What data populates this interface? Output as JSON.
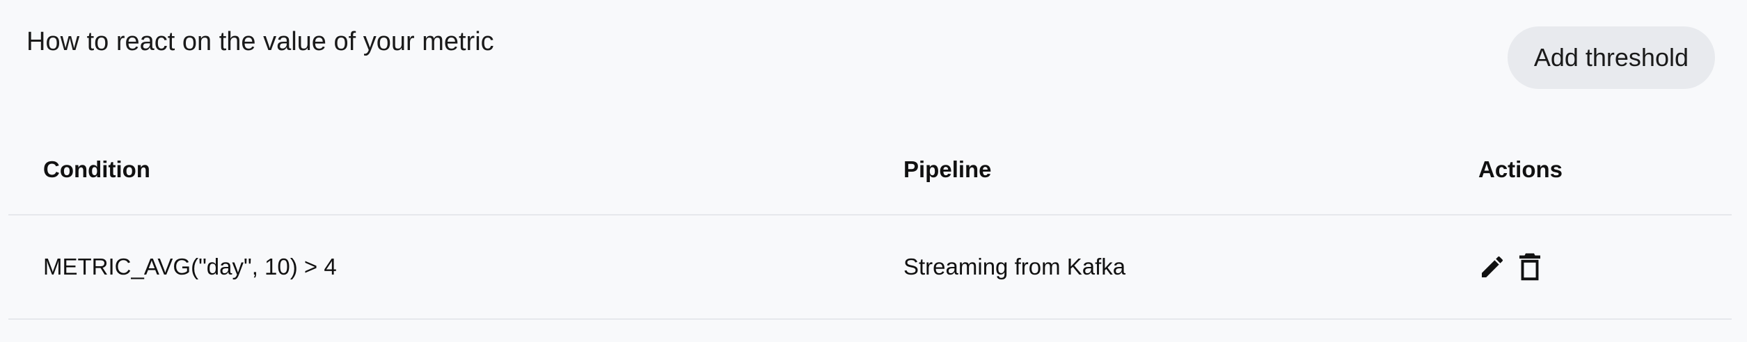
{
  "header": {
    "title": "How to react on the value of your metric",
    "add_button_label": "Add threshold"
  },
  "table": {
    "columns": [
      "Condition",
      "Pipeline",
      "Actions"
    ],
    "rows": [
      {
        "condition": "METRIC_AVG(\"day\", 10) > 4",
        "pipeline": "Streaming from Kafka",
        "actions": [
          "edit-icon",
          "delete-icon"
        ]
      }
    ]
  }
}
